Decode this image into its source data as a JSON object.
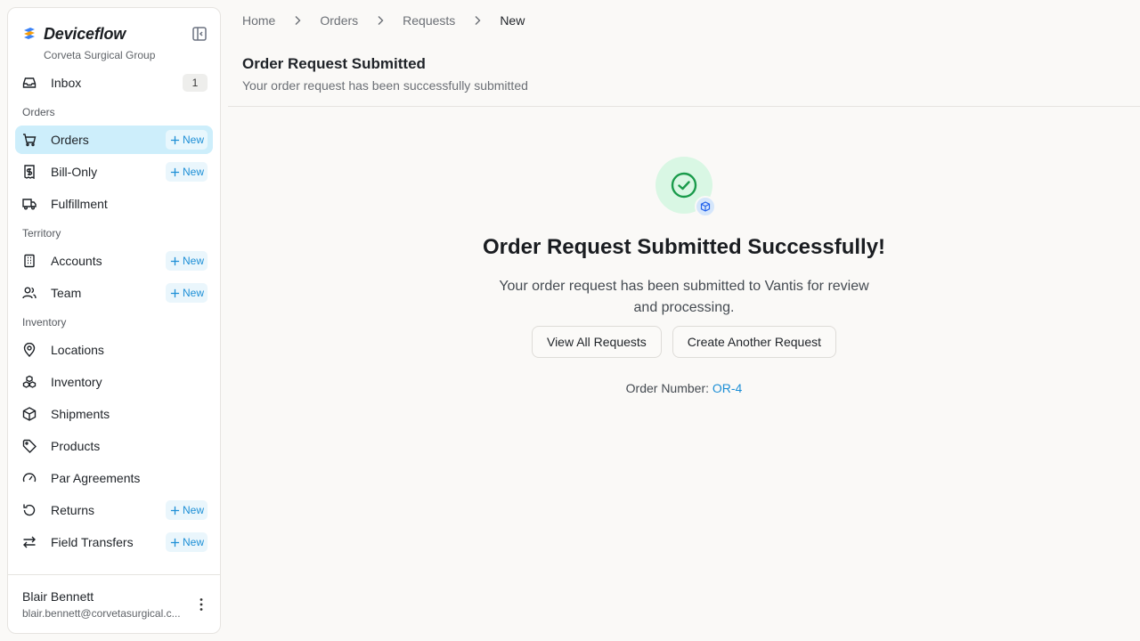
{
  "brand": {
    "name": "Deviceflow",
    "org": "Corveta Surgical Group"
  },
  "nav": {
    "inbox": {
      "label": "Inbox",
      "badge": "1"
    },
    "sections": {
      "orders": "Orders",
      "territory": "Territory",
      "inventory": "Inventory"
    },
    "new_label": "New",
    "items": {
      "orders": "Orders",
      "bill_only": "Bill-Only",
      "fulfillment": "Fulfillment",
      "accounts": "Accounts",
      "team": "Team",
      "locations": "Locations",
      "inventory": "Inventory",
      "shipments": "Shipments",
      "products": "Products",
      "par_agreements": "Par Agreements",
      "returns": "Returns",
      "field_transfers": "Field Transfers"
    }
  },
  "user": {
    "name": "Blair Bennett",
    "email": "blair.bennett@corvetasurgical.c..."
  },
  "breadcrumb": [
    "Home",
    "Orders",
    "Requests",
    "New"
  ],
  "header": {
    "title": "Order Request Submitted",
    "subtitle": "Your order request has been successfully submitted"
  },
  "success": {
    "heading": "Order Request Submitted Successfully!",
    "message": "Your order request has been submitted to Vantis for review and processing.",
    "view_all_label": "View All Requests",
    "create_another_label": "Create Another Request",
    "order_number_label": "Order Number:",
    "order_number_value": "OR-4"
  },
  "colors": {
    "accent": "#1d8fd6",
    "active_bg": "#cdeefb",
    "success": "#1a9b4b",
    "success_bg": "#d9f7e4"
  }
}
